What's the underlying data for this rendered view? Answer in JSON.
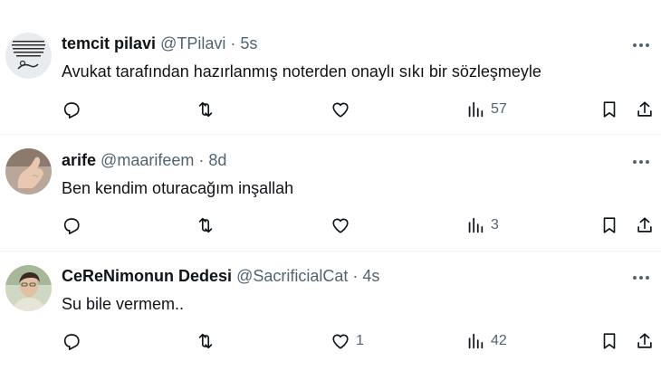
{
  "tweets": [
    {
      "name": "temcit pilavi",
      "handle": "@TPilavi",
      "sep": "·",
      "time": "5s",
      "text": "Avukat tarafından hazırlanmış noterden onaylı sıkı bir sözleşmeyle",
      "likes": "",
      "views": "57",
      "avatar": "meme-text-avatar"
    },
    {
      "name": "arife",
      "handle": "@maarifeem",
      "sep": "·",
      "time": "8d",
      "text": "Ben kendim oturacağım inşallah",
      "likes": "",
      "views": "3",
      "avatar": "hand-photo-avatar"
    },
    {
      "name": "CeReNimonun Dedesi",
      "handle": "@SacrificialCat",
      "sep": "·",
      "time": "4s",
      "text": "Su bile vermem..",
      "likes": "1",
      "views": "42",
      "avatar": "person-photo-avatar"
    }
  ],
  "icons": {
    "reply": "reply-icon",
    "retweet": "retweet-icon",
    "like": "heart-icon",
    "views": "views-icon",
    "bookmark": "bookmark-icon",
    "share": "share-icon",
    "more": "more-icon"
  },
  "colors": {
    "text": "#0f1419",
    "secondary": "#536471",
    "divider": "#eff3f4"
  }
}
